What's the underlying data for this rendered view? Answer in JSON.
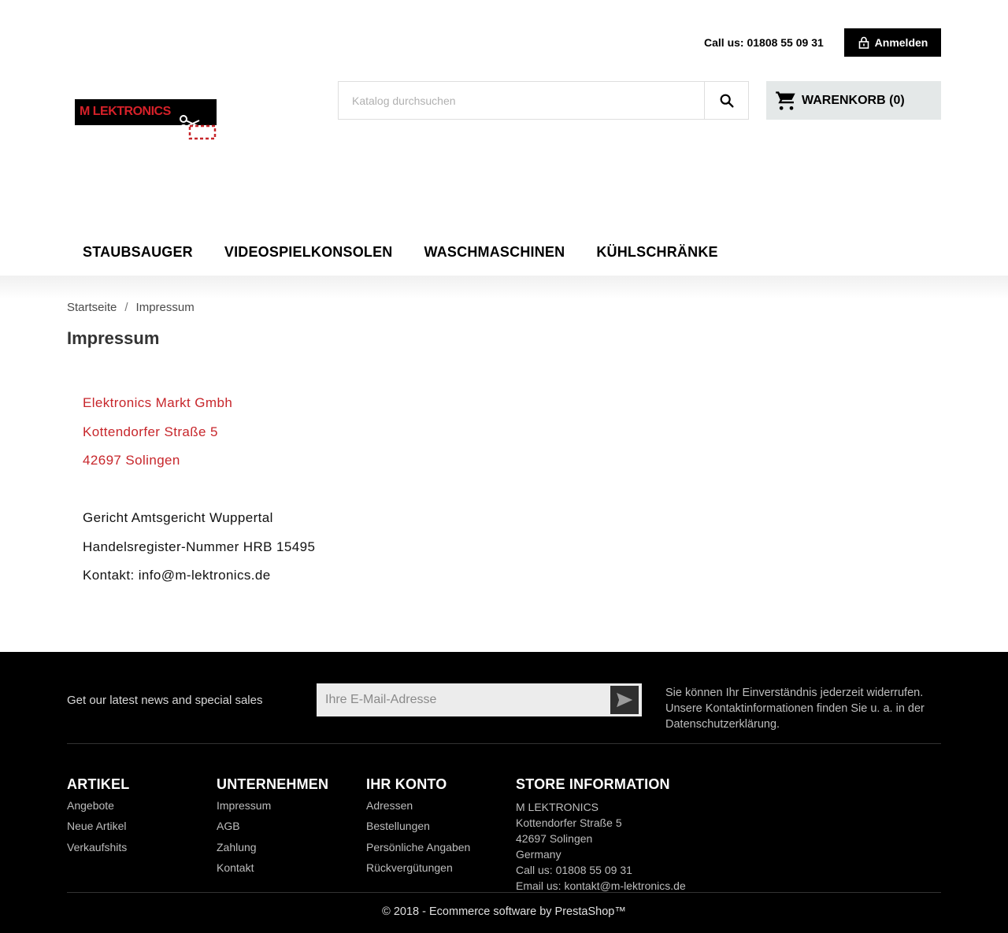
{
  "header": {
    "call_us": "Call us: 01808 55 09 31",
    "login_label": "Anmelden",
    "logo_text": "M LEKTRONICS",
    "search_placeholder": "Katalog durchsuchen",
    "cart_label": "WARENKORB (0)"
  },
  "nav": {
    "items": [
      "STAUBSAUGER",
      "VIDEOSPIELKONSOLEN",
      "WASCHMASCHINEN",
      "KÜHLSCHRÄNKE"
    ]
  },
  "breadcrumb": {
    "home": "Startseite",
    "separator": "/",
    "current": "Impressum"
  },
  "page": {
    "title": "Impressum",
    "address": [
      "Elektronics Markt Gmbh",
      "Kottendorfer Straße 5",
      "42697 Solingen"
    ],
    "legal": [
      "Gericht Amtsgericht Wuppertal",
      "Handelsregister-Nummer HRB 15495",
      "Kontakt: info@m-lektronics.de"
    ]
  },
  "footer": {
    "newsletter_text": "Get our latest news and special sales",
    "newsletter_placeholder": "Ihre E-Mail-Adresse",
    "consent_text": "Sie können Ihr Einverständnis jederzeit widerrufen. Unsere Kontaktinformationen finden Sie u. a. in der Datenschutzerklärung.",
    "columns": [
      {
        "title": "ARTIKEL",
        "links": [
          "Angebote",
          "Neue Artikel",
          "Verkaufshits"
        ]
      },
      {
        "title": "UNTERNEHMEN",
        "links": [
          "Impressum",
          "AGB",
          "Zahlung",
          "Kontakt"
        ]
      },
      {
        "title": "IHR KONTO",
        "links": [
          "Adressen",
          "Bestellungen",
          "Persönliche Angaben",
          "Rückvergütungen"
        ]
      }
    ],
    "store": {
      "title": "STORE INFORMATION",
      "lines": [
        "M LEKTRONICS",
        "Kottendorfer Straße 5",
        "42697 Solingen",
        "Germany",
        "Call us: 01808 55 09 31",
        "Email us: kontakt@m-lektronics.de"
      ]
    },
    "copyright": "© 2018 - Ecommerce software by PrestaShop™"
  },
  "colors": {
    "accent_red": "#c7262b",
    "footer_bg": "#000000",
    "cart_bg": "#e4e8e8"
  }
}
